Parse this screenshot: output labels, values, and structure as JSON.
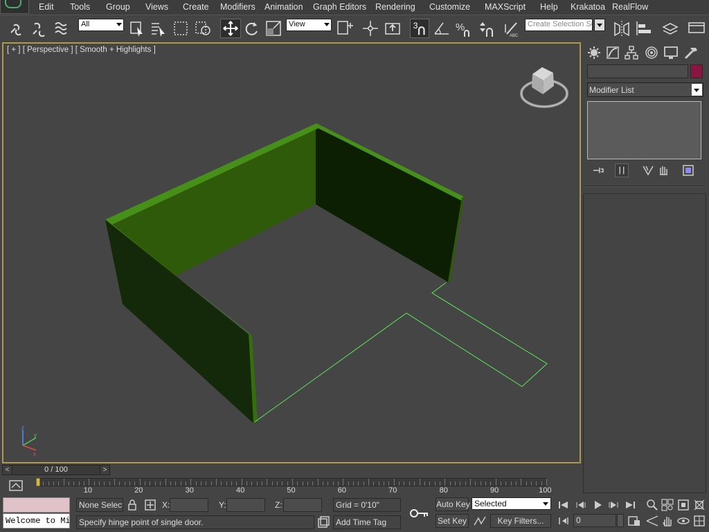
{
  "menu": {
    "items": [
      "Edit",
      "Tools",
      "Group",
      "Views",
      "Create",
      "Modifiers",
      "Animation",
      "Graph Editors",
      "Rendering",
      "Customize",
      "MAXScript",
      "Help",
      "Krakatoa",
      "RealFlow"
    ]
  },
  "toolbar": {
    "selection_filter": "All",
    "reference_coordinate": "View",
    "snap_toggle": "3",
    "selection_set_placeholder": "Create Selection Se",
    "icons": [
      "select-and-link-icon",
      "unlink-selection-icon",
      "bind-to-space-warp-icon",
      "select-object-icon",
      "select-by-name-icon",
      "rectangular-selection-icon",
      "window-crossing-icon",
      "select-and-move-icon",
      "select-and-rotate-icon",
      "select-and-scale-icon",
      "pivot-center-icon",
      "manipulate-icon",
      "keyboard-shortcut-icon",
      "snaps-toggle-icon",
      "angle-snap-icon",
      "percent-snap-icon",
      "spinner-snap-icon",
      "edit-named-selection-icon",
      "mirror-icon",
      "align-icon",
      "layer-manager-icon",
      "graphite-ribbon-icon"
    ]
  },
  "viewport": {
    "label": "[ + ] [ Perspective ] [ Smooth + Highlights ]",
    "wall_color": "#1f3a06",
    "wall_top_color": "#3f7d10",
    "floor_outline_color": "#5ae85a"
  },
  "command_panel": {
    "tabs": [
      "create-icon",
      "modify-icon",
      "hierarchy-icon",
      "motion-icon",
      "display-icon",
      "utilities-icon"
    ],
    "object_color": "#8a1442",
    "modifier_list": "Modifier List"
  },
  "time_slider": {
    "label": "0 / 100",
    "prev": "<",
    "next": ">"
  },
  "trackbar": {
    "tick_labels": [
      "10",
      "20",
      "30",
      "40",
      "50",
      "60",
      "70",
      "80",
      "90",
      "100"
    ]
  },
  "status": {
    "listener_text": "Welcome to Mi",
    "selection_info": "None Selecte",
    "x_label": "X:",
    "y_label": "Y:",
    "z_label": "Z:",
    "grid": "Grid = 0'10\"",
    "prompt": "Specify hinge point of single door.",
    "add_time_tag": "Add Time Tag",
    "auto_key": "Auto Key",
    "set_key": "Set Key",
    "key_mode": "Selected",
    "key_filters": "Key Filters...",
    "current_frame": "0"
  }
}
